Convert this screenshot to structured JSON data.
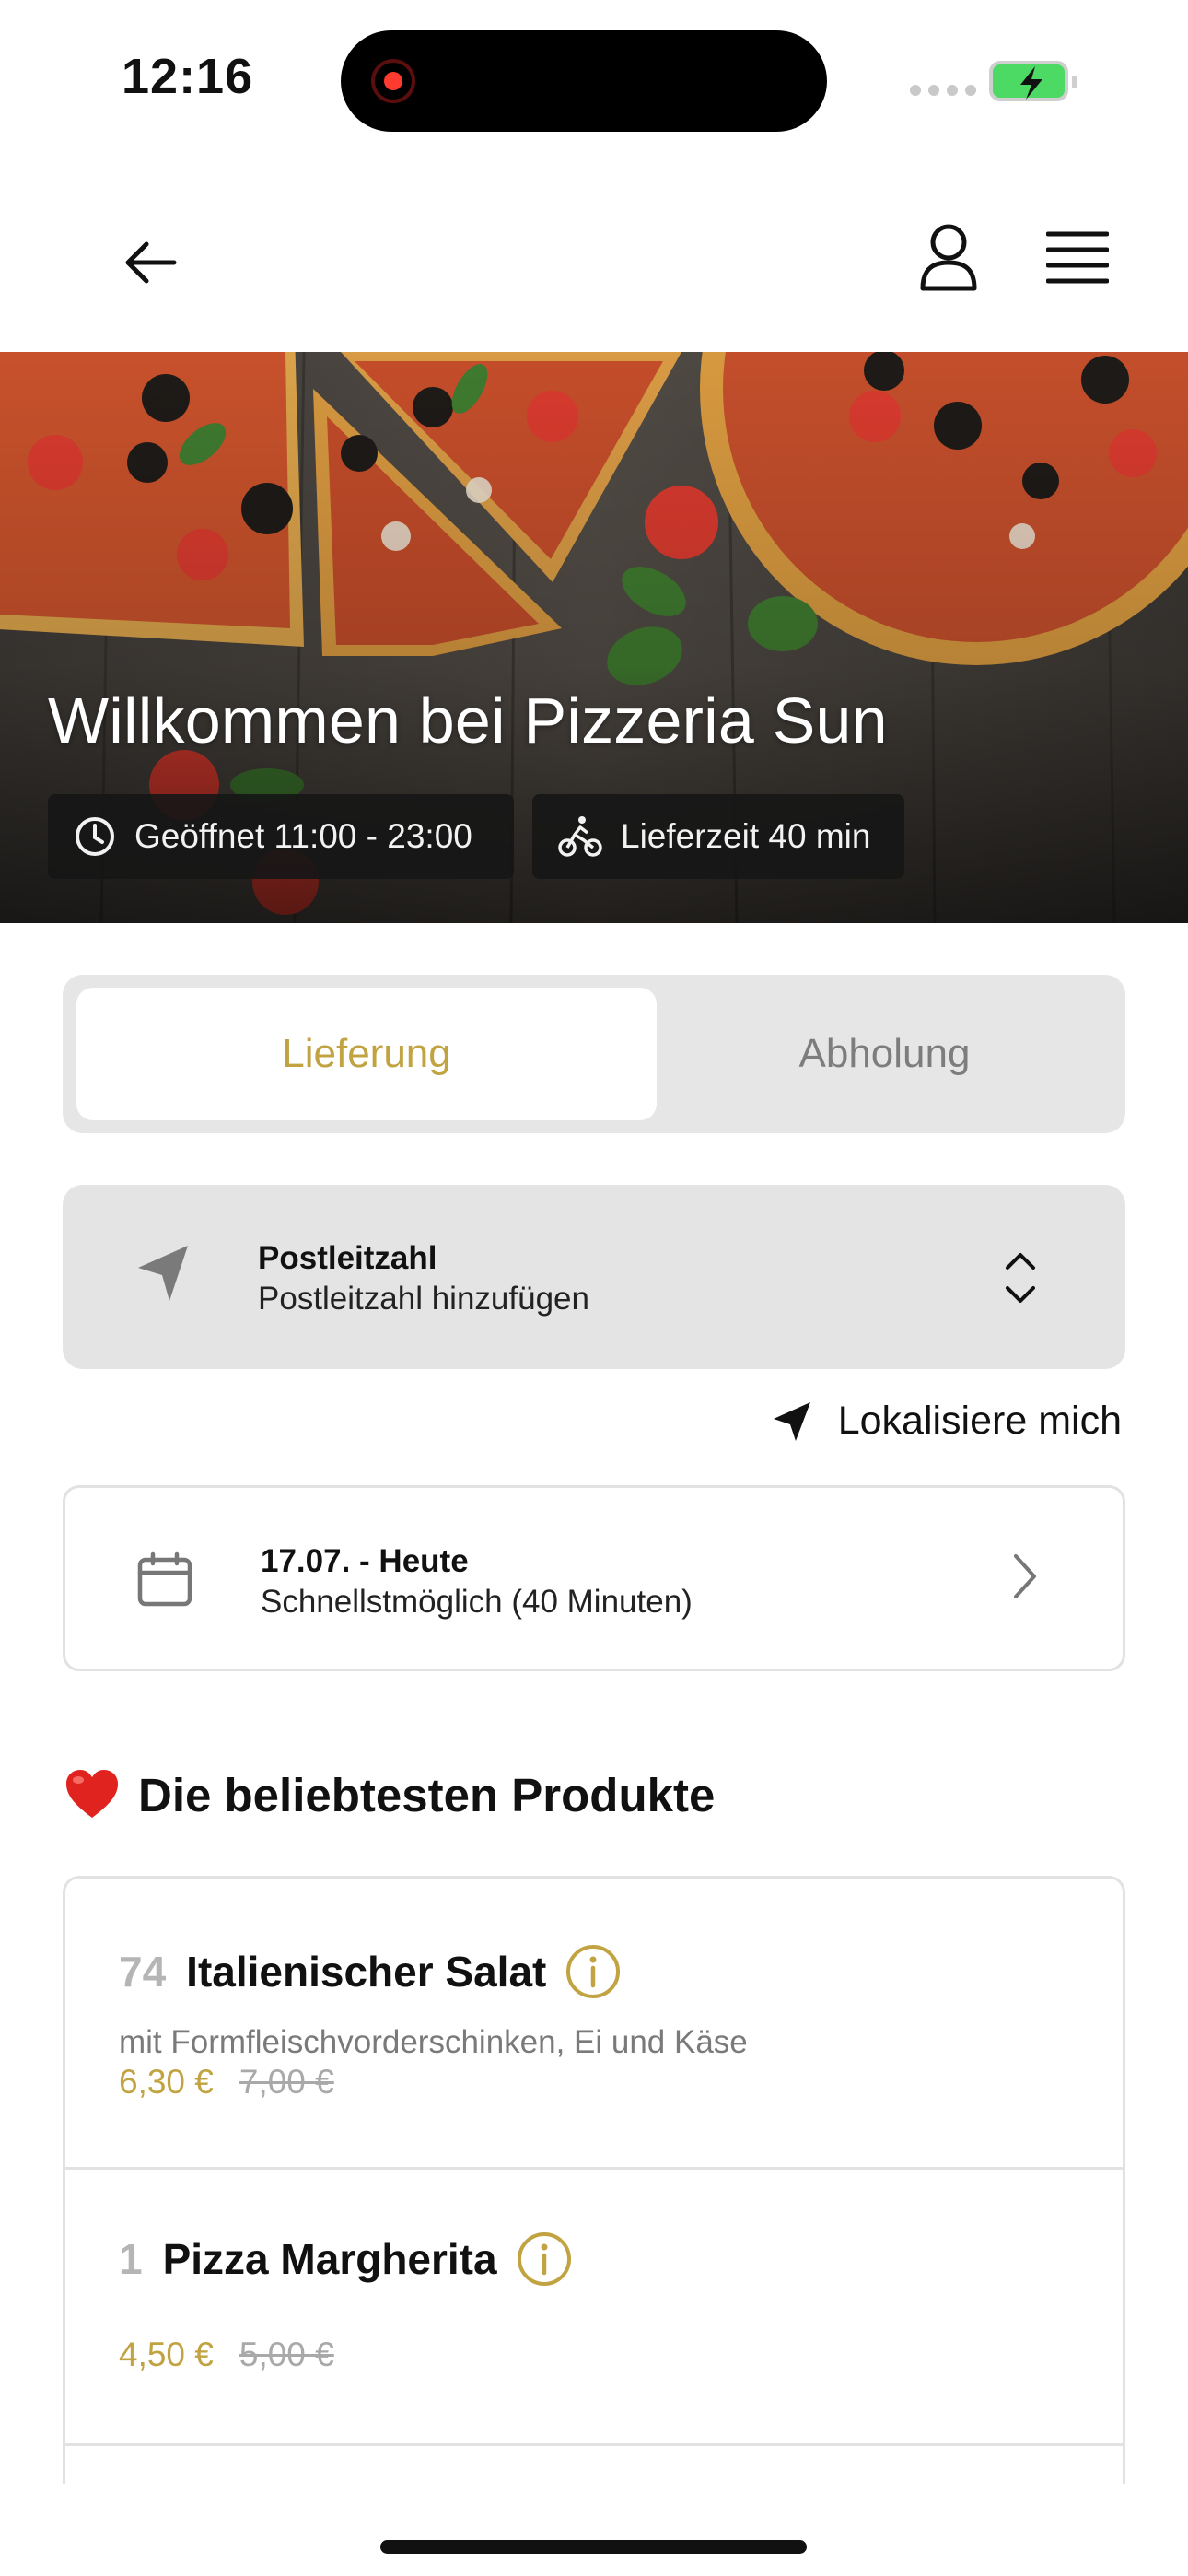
{
  "status_bar": {
    "time": "12:16"
  },
  "hero": {
    "title": "Willkommen bei Pizzeria Sun",
    "opening_hours": "Geöffnet 11:00 - 23:00",
    "delivery_time": "Lieferzeit 40 min"
  },
  "order_mode": {
    "options": [
      "Lieferung",
      "Abholung"
    ],
    "selected": "Lieferung"
  },
  "postcode": {
    "label": "Postleitzahl",
    "placeholder": "Postleitzahl hinzufügen"
  },
  "locate": {
    "label": "Lokalisiere mich"
  },
  "delivery_date": {
    "title": "17.07. - Heute",
    "subtitle": "Schnellstmöglich (40 Minuten)"
  },
  "popular": {
    "title": "Die beliebtesten Produkte",
    "products": [
      {
        "number": "74",
        "name": "Italienischer Salat",
        "description": "mit Formfleischvorderschinken, Ei und Käse",
        "price": "6,30 €",
        "old_price": "7,00 €"
      },
      {
        "number": "1",
        "name": "Pizza Margherita",
        "description": "",
        "price": "4,50 €",
        "old_price": "5,00 €"
      }
    ]
  },
  "colors": {
    "accent": "#c1a342",
    "muted_text": "#7a7a7a",
    "box_background": "#e4e4e4"
  },
  "icons": {
    "back": "arrow-left-icon",
    "user": "user-icon",
    "menu": "hamburger-menu-icon",
    "clock": "clock-icon",
    "bike": "bicycle-icon",
    "navigation": "navigation-arrow-icon",
    "calendar": "calendar-icon",
    "info": "info-icon",
    "heart": "heart-icon"
  }
}
